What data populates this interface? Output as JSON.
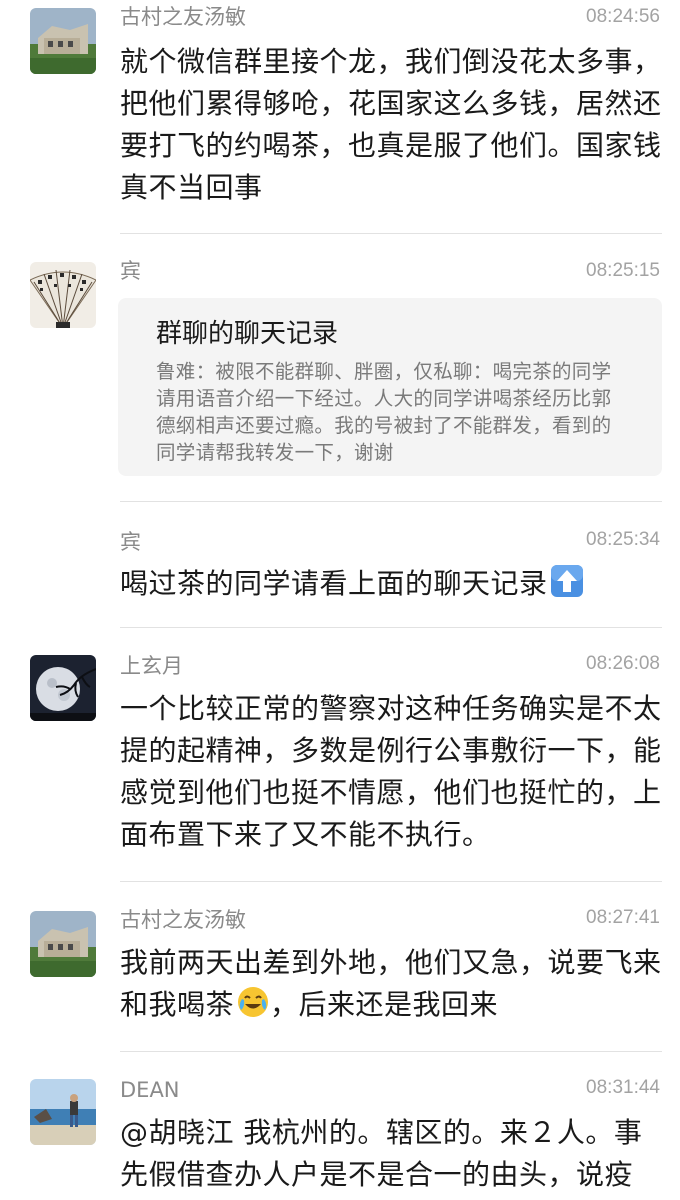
{
  "messages": [
    {
      "name": "古村之友汤敏",
      "time": "08:24:56",
      "text": "就个微信群里接个龙，我们倒没花太多事，把他们累得够呛，花国家这么多钱，居然还要打飞的约喝茶，也真是服了他们。国家钱真不当回事",
      "avatar": "village-photo"
    },
    {
      "name": "宾",
      "time": "08:25:15",
      "avatar": "calligraphy-fan",
      "card": {
        "title": "群聊的聊天记录",
        "text": "鲁难：被限不能群聊、胖圈，仅私聊：喝完茶的同学请用语音介绍一下经过。人大的同学讲喝茶经历比郭德纲相声还要过瘾。我的号被封了不能群发，看到的同学请帮我转发一下，谢谢"
      }
    },
    {
      "name": "宾",
      "time": "08:25:34",
      "text": "喝过茶的同学请看上面的聊天记录",
      "emoji": "up-arrow-emoji"
    },
    {
      "name": "上玄月",
      "time": "08:26:08",
      "text": "一个比较正常的警察对这种任务确实是不太提的起精神，多数是例行公事敷衍一下，能感觉到他们也挺不情愿，他们也挺忙的，上面布置下来了又不能不执行。",
      "avatar": "moon-photo"
    },
    {
      "name": "古村之友汤敏",
      "time": "08:27:41",
      "text_before": "我前两天出差到外地，他们又急，说要飞来和我喝茶",
      "text_after": "，后来还是我回来",
      "emoji": "crying-laughing-emoji",
      "avatar": "village-photo"
    },
    {
      "name": "DEAN",
      "time": "08:31:44",
      "text": "@胡晓江 我杭州的。辖区的。来２人。事先假借查办人户是不是合一的由头，说疫",
      "avatar": "seaside-photo"
    }
  ],
  "colors": {
    "name": "#8a8a8a",
    "time": "#a3a3a3",
    "text": "#1a1a1a",
    "card_bg": "#f4f4f4",
    "divider": "#e2e2e2"
  }
}
